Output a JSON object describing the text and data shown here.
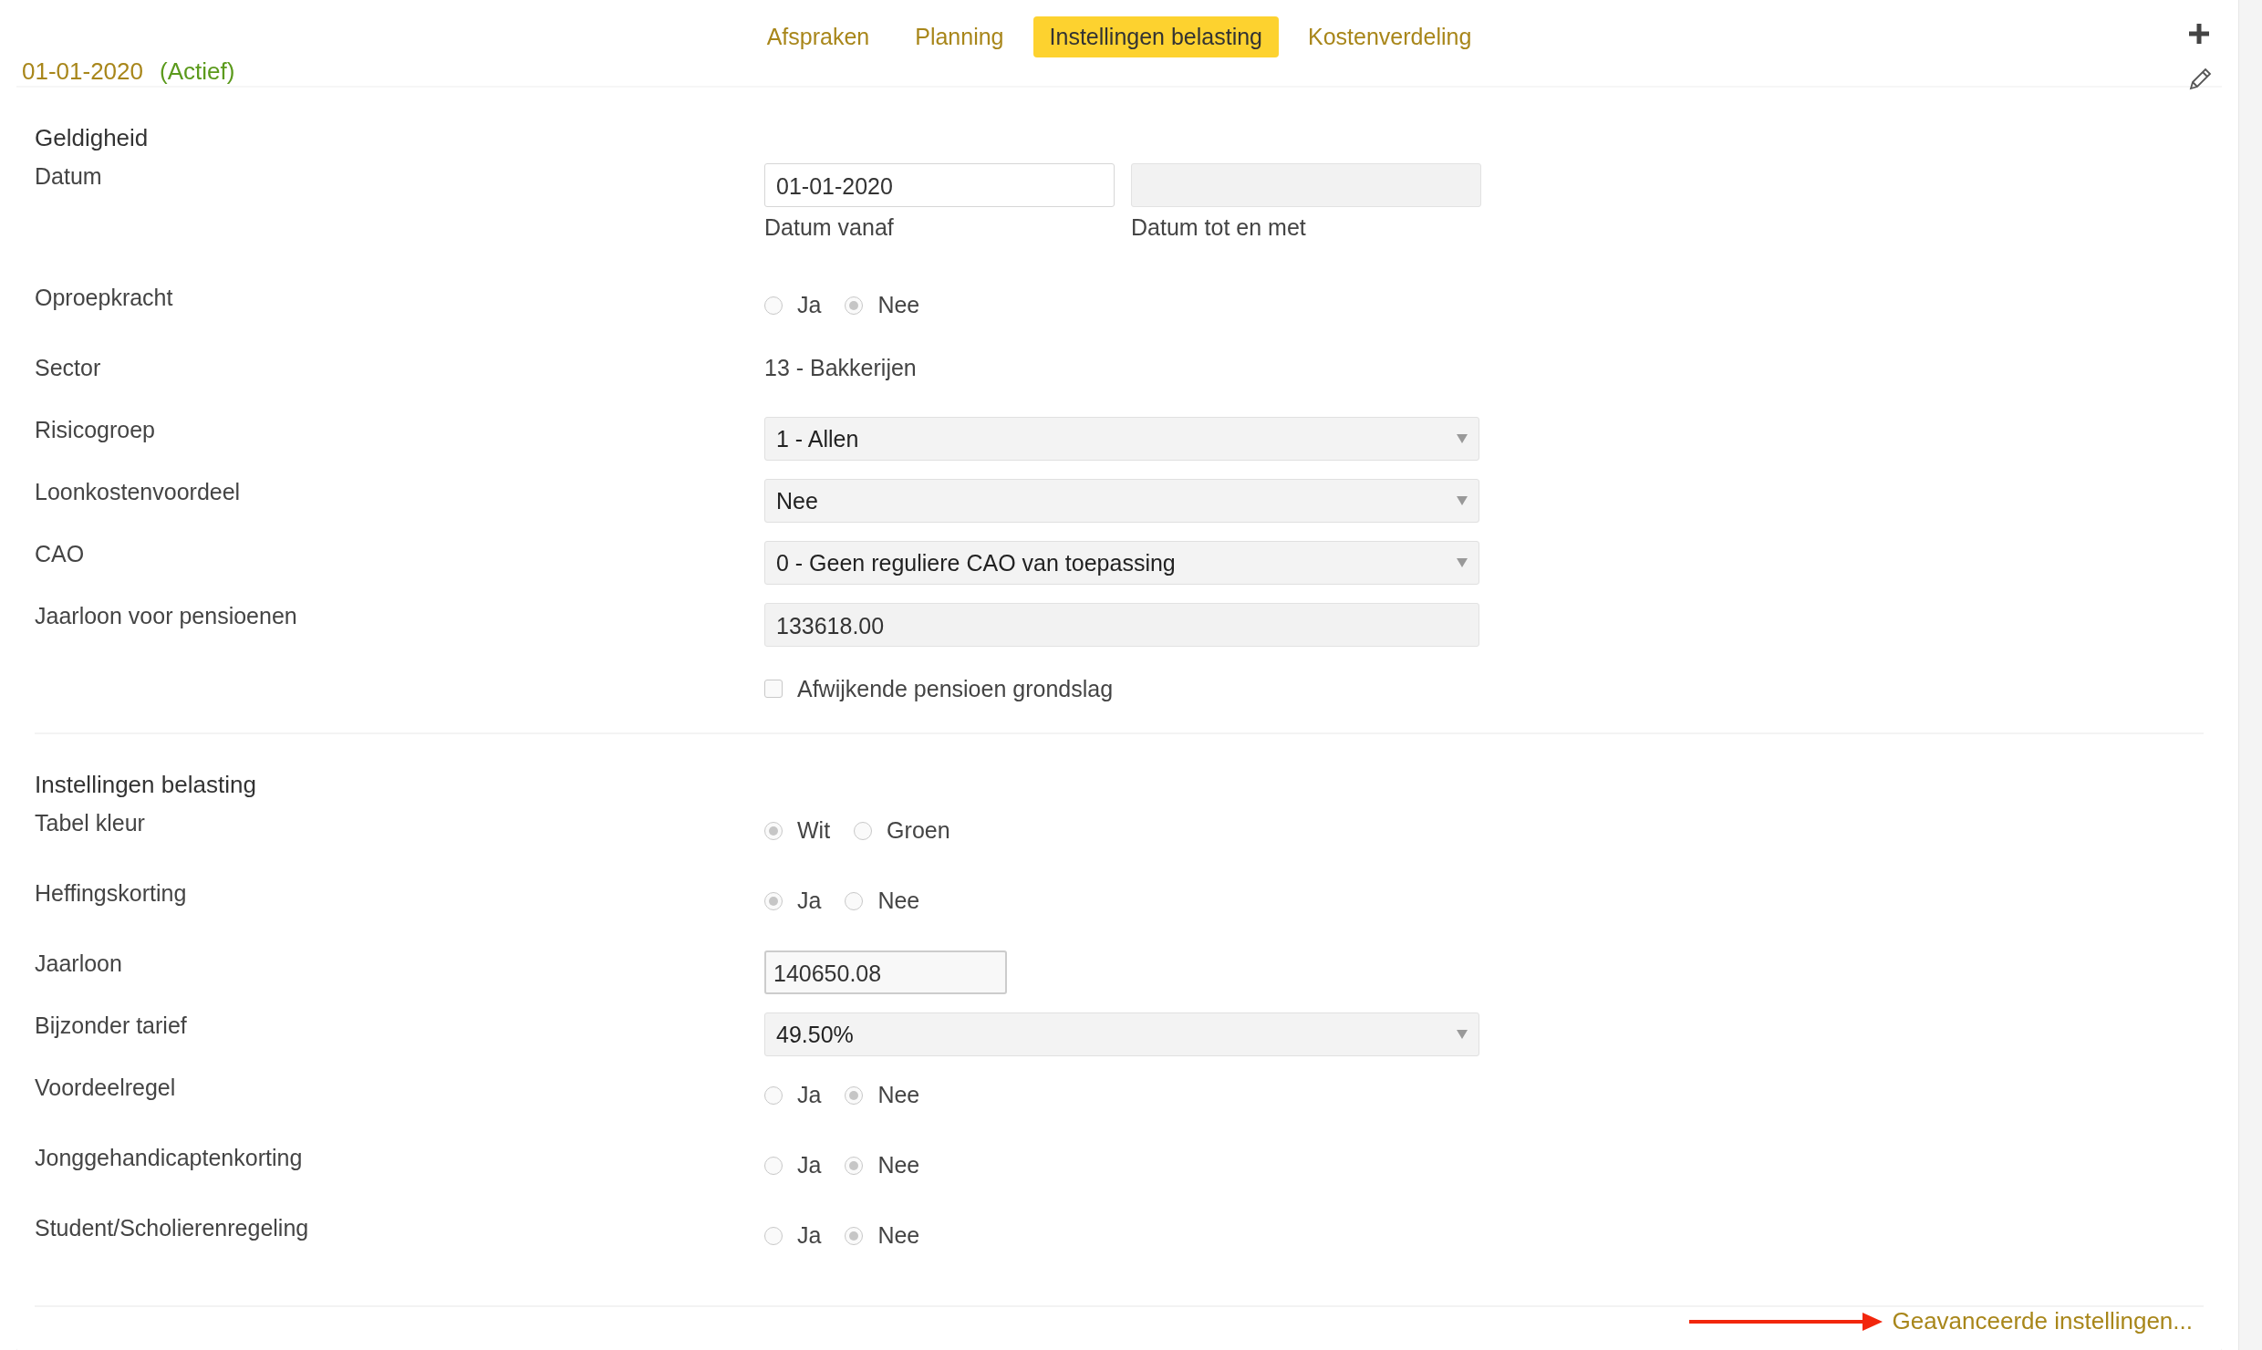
{
  "tabs": [
    {
      "label": "Afspraken",
      "selected": false
    },
    {
      "label": "Planning",
      "selected": false
    },
    {
      "label": "Instellingen belasting",
      "selected": true
    },
    {
      "label": "Kostenverdeling",
      "selected": false
    }
  ],
  "period": {
    "date": "01-01-2020",
    "status": "(Actief)"
  },
  "sections": [
    {
      "title": "Geldigheid",
      "fields": [
        {
          "kind": "dates",
          "label": "Datum",
          "inputs": [
            {
              "value": "01-01-2020",
              "caption": "Datum vanaf",
              "disabled": false
            },
            {
              "caption": "Datum tot en met",
              "disabled": true
            }
          ]
        },
        {
          "kind": "radio",
          "label": "Oproepkracht",
          "options": [
            {
              "label": "Ja",
              "selected": false
            },
            {
              "label": "Nee",
              "selected": true
            }
          ]
        },
        {
          "kind": "text",
          "label": "Sector",
          "value": "13 - Bakkerijen"
        },
        {
          "kind": "select",
          "label": "Risicogroep",
          "value": "1 - Allen"
        },
        {
          "kind": "select",
          "label": "Loonkostenvoordeel",
          "value": "Nee"
        },
        {
          "kind": "select",
          "label": "CAO",
          "value": "0 - Geen reguliere CAO van toepassing"
        },
        {
          "kind": "input",
          "label": "Jaarloon voor pensioenen",
          "value": "133618.00",
          "disabled": true
        },
        {
          "kind": "checkbox",
          "text": "Afwijkende pensioen grondslag",
          "checked": false
        }
      ]
    },
    {
      "title": "Instellingen belasting",
      "fields": [
        {
          "kind": "radio",
          "label": "Tabel kleur",
          "options": [
            {
              "label": "Wit",
              "selected": true
            },
            {
              "label": "Groen",
              "selected": false
            }
          ]
        },
        {
          "kind": "radio",
          "label": "Heffingskorting",
          "options": [
            {
              "label": "Ja",
              "selected": true
            },
            {
              "label": "Nee",
              "selected": false
            }
          ]
        },
        {
          "kind": "short_input",
          "label": "Jaarloon",
          "value": "140650.08"
        },
        {
          "kind": "select",
          "label": "Bijzonder tarief",
          "value": "49.50%"
        },
        {
          "kind": "radio",
          "label": "Voordeelregel",
          "options": [
            {
              "label": "Ja",
              "selected": false
            },
            {
              "label": "Nee",
              "selected": true
            }
          ]
        },
        {
          "kind": "radio",
          "label": "Jonggehandicaptenkorting",
          "options": [
            {
              "label": "Ja",
              "selected": false
            },
            {
              "label": "Nee",
              "selected": true
            }
          ]
        },
        {
          "kind": "radio",
          "label": "Student/Scholierenregeling",
          "options": [
            {
              "label": "Ja",
              "selected": false
            },
            {
              "label": "Nee",
              "selected": true
            }
          ]
        }
      ]
    }
  ],
  "advanced_link": "Geavanceerde instellingen..."
}
